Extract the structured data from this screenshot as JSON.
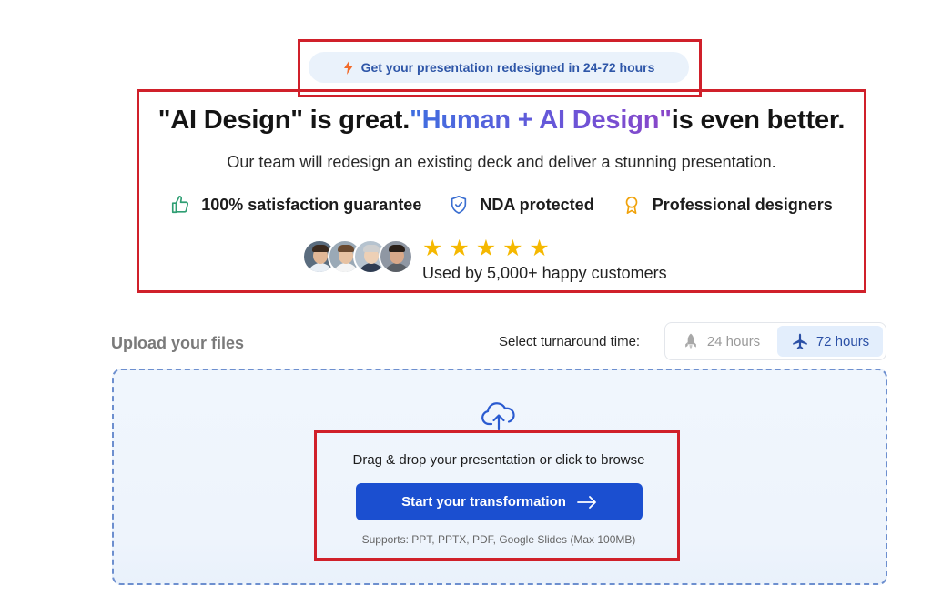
{
  "promo": {
    "text": "Get your presentation redesigned in 24-72 hours"
  },
  "headline": {
    "part1": "\"AI Design\" is great.",
    "part2": "\"Human + AI Design\"",
    "part3": "is even better."
  },
  "subheadline": "Our team will redesign an existing deck and deliver a stunning presentation.",
  "features": [
    {
      "icon": "thumbs-up-icon",
      "label": "100% satisfaction guarantee",
      "color": "#2f9e73"
    },
    {
      "icon": "shield-check-icon",
      "label": "NDA protected",
      "color": "#3b6fd1"
    },
    {
      "icon": "award-icon",
      "label": "Professional designers",
      "color": "#f0a20a"
    }
  ],
  "social_proof": {
    "rating": 5,
    "stars": "★ ★ ★ ★ ★",
    "text": "Used by 5,000+ happy customers"
  },
  "upload": {
    "title": "Upload your files",
    "turnaround_label": "Select turnaround time:",
    "options": [
      {
        "label": "24 hours",
        "icon": "rocket-icon",
        "selected": false
      },
      {
        "label": "72 hours",
        "icon": "airplane-icon",
        "selected": true
      }
    ],
    "drop_text": "Drag & drop your presentation or click to browse",
    "cta_label": "Start your transformation",
    "supports": "Supports: PPT, PPTX, PDF, Google Slides (Max 100MB)"
  },
  "colors": {
    "accent": "#1b4fd0",
    "highlight_box": "#d0202a",
    "star": "#f5b800"
  }
}
